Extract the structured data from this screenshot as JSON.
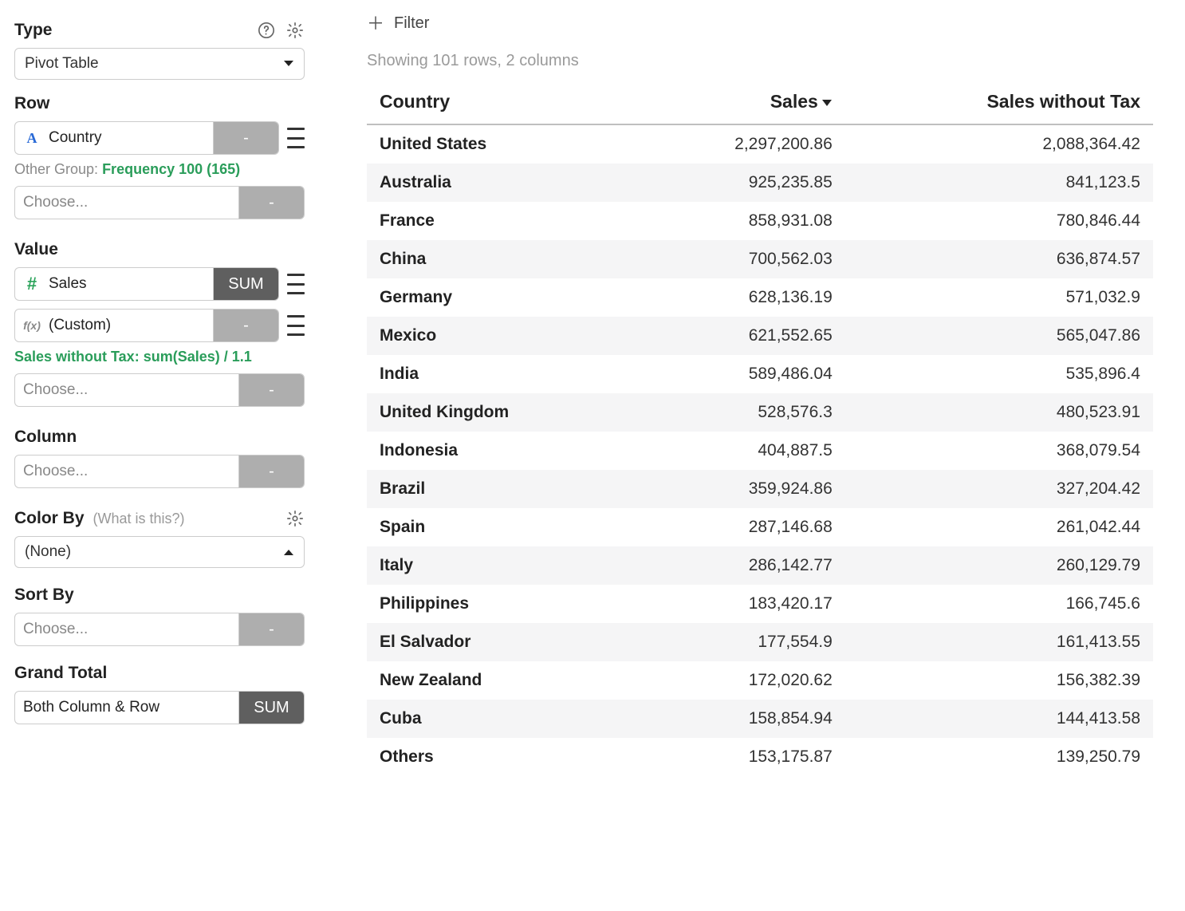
{
  "sidebar": {
    "type": {
      "label": "Type",
      "value": "Pivot Table"
    },
    "row": {
      "label": "Row",
      "field": "Country",
      "agg": "-",
      "other_group_prefix": "Other Group: ",
      "other_group_value": "Frequency 100 (165)",
      "choose_placeholder": "Choose...",
      "choose_agg": "-"
    },
    "value": {
      "label": "Value",
      "field": "Sales",
      "agg": "SUM",
      "custom_field": "(Custom)",
      "custom_agg": "-",
      "custom_note": "Sales without Tax: sum(Sales) / 1.1",
      "choose_placeholder": "Choose...",
      "choose_agg": "-"
    },
    "column": {
      "label": "Column",
      "choose_placeholder": "Choose...",
      "choose_agg": "-"
    },
    "color_by": {
      "label": "Color By",
      "hint": "(What is this?)",
      "value": "(None)"
    },
    "sort_by": {
      "label": "Sort By",
      "choose_placeholder": "Choose...",
      "choose_agg": "-"
    },
    "grand_total": {
      "label": "Grand Total",
      "value": "Both Column & Row",
      "agg": "SUM"
    }
  },
  "main": {
    "filter_label": "Filter",
    "showing": "Showing 101 rows, 2 columns",
    "columns": [
      "Country",
      "Sales",
      "Sales without Tax"
    ],
    "sort_column": "Sales",
    "rows": [
      {
        "country": "United States",
        "sales": "2,297,200.86",
        "sales_no_tax": "2,088,364.42"
      },
      {
        "country": "Australia",
        "sales": "925,235.85",
        "sales_no_tax": "841,123.5"
      },
      {
        "country": "France",
        "sales": "858,931.08",
        "sales_no_tax": "780,846.44"
      },
      {
        "country": "China",
        "sales": "700,562.03",
        "sales_no_tax": "636,874.57"
      },
      {
        "country": "Germany",
        "sales": "628,136.19",
        "sales_no_tax": "571,032.9"
      },
      {
        "country": "Mexico",
        "sales": "621,552.65",
        "sales_no_tax": "565,047.86"
      },
      {
        "country": "India",
        "sales": "589,486.04",
        "sales_no_tax": "535,896.4"
      },
      {
        "country": "United Kingdom",
        "sales": "528,576.3",
        "sales_no_tax": "480,523.91"
      },
      {
        "country": "Indonesia",
        "sales": "404,887.5",
        "sales_no_tax": "368,079.54"
      },
      {
        "country": "Brazil",
        "sales": "359,924.86",
        "sales_no_tax": "327,204.42"
      },
      {
        "country": "Spain",
        "sales": "287,146.68",
        "sales_no_tax": "261,042.44"
      },
      {
        "country": "Italy",
        "sales": "286,142.77",
        "sales_no_tax": "260,129.79"
      },
      {
        "country": "Philippines",
        "sales": "183,420.17",
        "sales_no_tax": "166,745.6"
      },
      {
        "country": "El Salvador",
        "sales": "177,554.9",
        "sales_no_tax": "161,413.55"
      },
      {
        "country": "New Zealand",
        "sales": "172,020.62",
        "sales_no_tax": "156,382.39"
      },
      {
        "country": "Cuba",
        "sales": "158,854.94",
        "sales_no_tax": "144,413.58"
      },
      {
        "country": "Others",
        "sales": "153,175.87",
        "sales_no_tax": "139,250.79"
      }
    ]
  }
}
